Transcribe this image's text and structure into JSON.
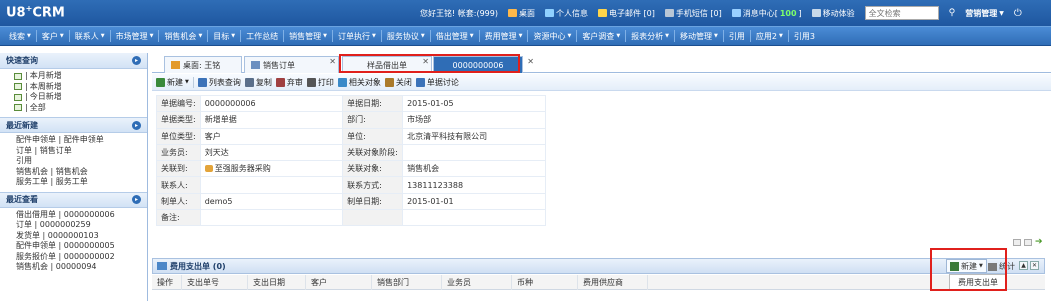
{
  "logo": {
    "text": "U8",
    "sup": "+",
    "suffix": "CRM"
  },
  "top": {
    "welcome": "您好王铭! 帐套:(999)",
    "items": [
      {
        "label": "桌面",
        "icon": "desktop-icon",
        "color": "#ffb84a"
      },
      {
        "label": "个人信息",
        "icon": "user-icon",
        "color": "#8fd0ff"
      },
      {
        "label": "电子邮件 [0]",
        "icon": "mail-icon",
        "color": "#ffd54a"
      },
      {
        "label": "手机短信 [0]",
        "icon": "phone-icon",
        "color": "#b9c7d6"
      }
    ],
    "msg_prefix": "消息中心[",
    "msg_count": "100",
    "msg_suffix": "]",
    "mobile": "移动体验",
    "search_placeholder": "全文检索",
    "settings": "营销管理",
    "logout_icon": "power-icon"
  },
  "menu": [
    "线索",
    "客户",
    "联系人",
    "市场管理",
    "销售机会",
    "目标",
    "工作总结",
    "销售管理",
    "订单执行",
    "服务协议",
    "借出管理",
    "费用管理",
    "资源中心",
    "客户调查",
    "报表分析",
    "移动管理",
    "引用",
    "应用2",
    "引用3"
  ],
  "menu_has_caret": [
    true,
    true,
    true,
    true,
    true,
    true,
    false,
    true,
    true,
    true,
    true,
    true,
    true,
    true,
    true,
    true,
    false,
    true,
    false
  ],
  "sidebar": {
    "quick": {
      "title": "快速查询",
      "items": [
        "本月新增",
        "本周新增",
        "今日新增",
        "全部"
      ]
    },
    "recent_new": {
      "title": "最近新建",
      "items": [
        "配件申领单 | 配件申领单",
        "订单 | 销售订单",
        "引用",
        "销售机会 | 销售机会",
        "服务工单 | 服务工单"
      ]
    },
    "recent_view": {
      "title": "最近查看",
      "items": [
        "借出借用单 | 0000000006",
        "订单 | 0000000259",
        "发货单 | 0000000103",
        "配件申领单 | 0000000005",
        "服务报价单 | 0000000002",
        "销售机会 | 00000094"
      ]
    }
  },
  "tabs": [
    {
      "label": "桌面: 王铭",
      "icon": "home-icon"
    },
    {
      "label": "销售订单",
      "icon": "doc-icon"
    },
    {
      "label": "样品借出单",
      "icon": ""
    },
    {
      "label": "0000000006",
      "icon": ""
    }
  ],
  "toolbar": [
    {
      "label": "新建",
      "icon": "new-icon",
      "color": "#3a8a3a",
      "caret": true
    },
    {
      "label": "列表查询",
      "icon": "list-icon",
      "color": "#3b72b8"
    },
    {
      "label": "复制",
      "icon": "copy-icon",
      "color": "#5a6f8a"
    },
    {
      "label": "弃审",
      "icon": "unapprove-icon",
      "color": "#a04040"
    },
    {
      "label": "打印",
      "icon": "print-icon",
      "color": "#555"
    },
    {
      "label": "相关对象",
      "icon": "related-icon",
      "color": "#3a8ac8"
    },
    {
      "label": "关闭",
      "icon": "close-doc-icon",
      "color": "#aa7a2a"
    },
    {
      "label": "单据讨论",
      "icon": "discuss-icon",
      "color": "#3b72b8"
    }
  ],
  "form": [
    [
      "单据编号:",
      "0000000006",
      "单据日期:",
      "2015-01-05"
    ],
    [
      "单据类型:",
      "新增单据",
      "部门:",
      "市场部"
    ],
    [
      "单位类型:",
      "客户",
      "单位:",
      "北京清平科技有限公司"
    ],
    [
      "业务员:",
      "刘天达",
      "关联对象阶段:",
      ""
    ],
    [
      "关联到:",
      "至强服务器采购",
      "关联对象:",
      "销售机会"
    ],
    [
      "联系人:",
      "",
      "联系方式:",
      "13811123388"
    ],
    [
      "制单人:",
      "demo5",
      "制单日期:",
      "2015-01-01"
    ],
    [
      "备注:",
      "",
      "",
      ""
    ]
  ],
  "subgrid": {
    "title": "费用支出单 (0)",
    "new_label": "新建",
    "stat_label": "统计",
    "dropdown_item": "费用支出单",
    "columns": [
      "操作",
      "支出单号",
      "支出日期",
      "客户",
      "销售部门",
      "业务员",
      "币种",
      "费用供应商"
    ]
  },
  "colors": {
    "highlight_box": "#e0201c",
    "accent": "#2f6db6"
  }
}
